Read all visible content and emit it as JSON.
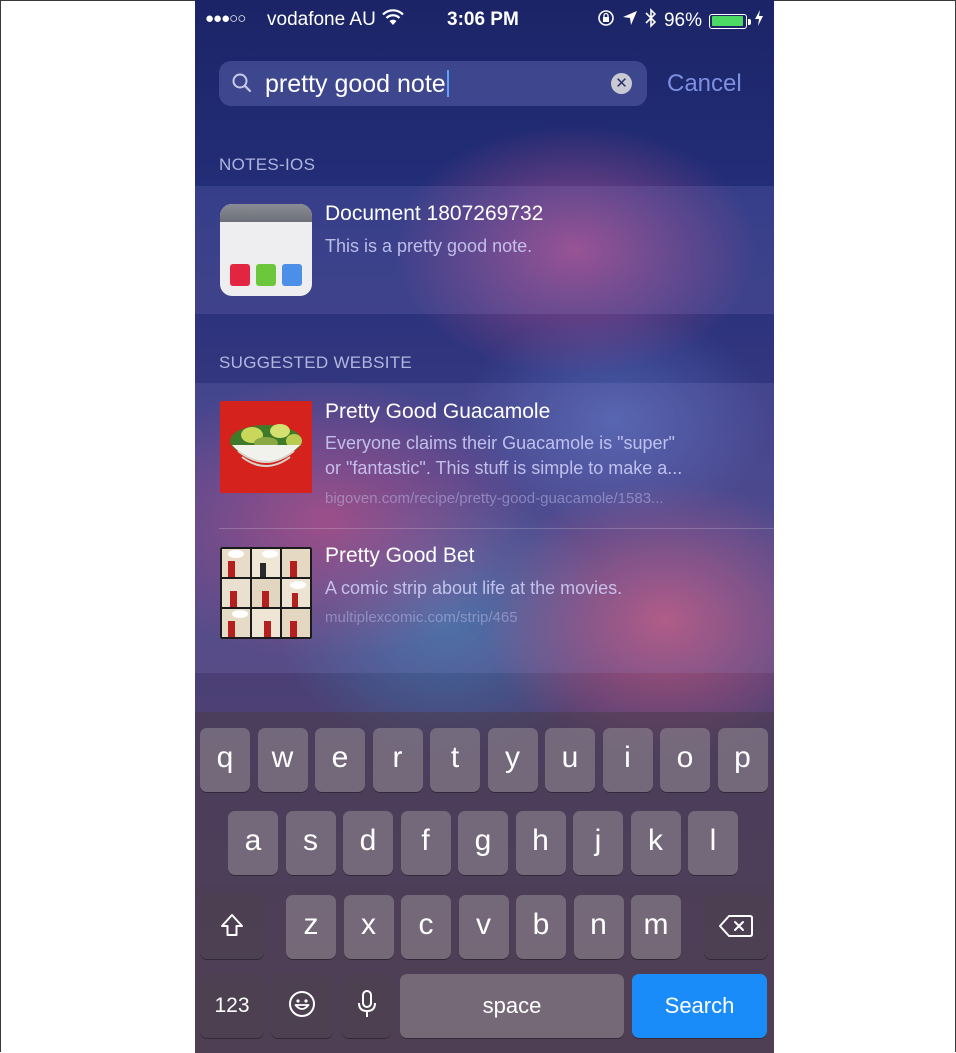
{
  "status_bar": {
    "signal": "●●●○○",
    "carrier": "vodafone AU",
    "time": "3:06 PM",
    "battery": "96%",
    "battery_level": 0.96,
    "icons": [
      "wifi-icon",
      "orientation-lock-icon",
      "location-icon",
      "bluetooth-icon",
      "battery-icon",
      "charging-icon"
    ]
  },
  "search": {
    "query": "pretty good note",
    "cancel_label": "Cancel"
  },
  "sections": [
    {
      "header": "NOTES-IOS",
      "results": [
        {
          "title": "Document 1807269732",
          "subtitle": "This is a pretty good note.",
          "icon": "notes-app-icon"
        }
      ]
    },
    {
      "header": "SUGGESTED WEBSITE",
      "results": [
        {
          "title": "Pretty Good Guacamole",
          "subtitle_line1": "Everyone claims their Guacamole is \"super\"",
          "subtitle_line2": "or \"fantastic\". This stuff is simple to make a...",
          "url": "bigoven.com/recipe/pretty-good-guacamole/1583...",
          "thumbnail": "guacamole-thumbnail"
        },
        {
          "title": "Pretty Good Bet",
          "subtitle": "A comic strip about life at the movies.",
          "url": "multiplexcomic.com/strip/465",
          "thumbnail": "comic-thumbnail"
        }
      ]
    }
  ],
  "keyboard": {
    "row1": [
      "q",
      "w",
      "e",
      "r",
      "t",
      "y",
      "u",
      "i",
      "o",
      "p"
    ],
    "row2": [
      "a",
      "s",
      "d",
      "f",
      "g",
      "h",
      "j",
      "k",
      "l"
    ],
    "row3": [
      "z",
      "x",
      "c",
      "v",
      "b",
      "n",
      "m"
    ],
    "numbers_label": "123",
    "space_label": "space",
    "search_label": "Search"
  },
  "colors": {
    "accent": "#1a8cfa",
    "cancel": "#7d8fe0"
  }
}
